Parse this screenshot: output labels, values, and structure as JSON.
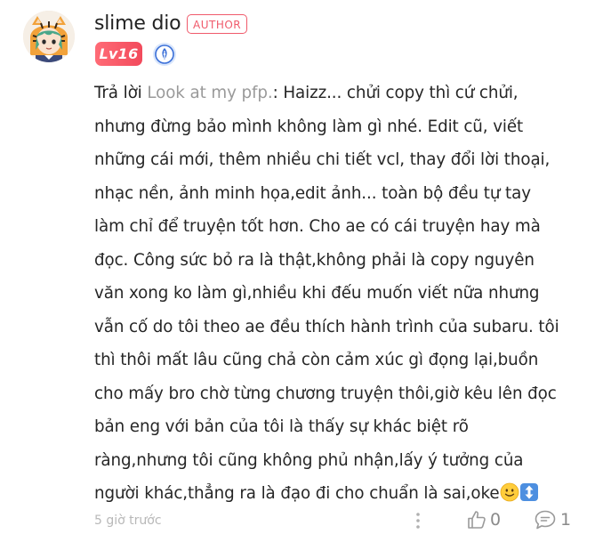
{
  "user": {
    "name": "slime dio",
    "author_badge": "AUTHOR",
    "level": "Lv16"
  },
  "comment": {
    "reply_prefix": "Trả lời ",
    "reply_to": "Look at my pfp.",
    "reply_rest": ": Haizz... chửi copy thì cứ chửi,\nnhưng đừng bảo mình không làm gì nhé. Edit cũ, viết\nnhững cái mới, thêm nhiều chi tiết vcl, thay đổi lời thoại,\nnhạc nền, ảnh minh họa,edit ảnh... toàn bộ đều tự tay\nlàm chỉ để truyện tốt hơn. Cho ae có cái truyện hay mà\nđọc. Công sức bỏ ra là thật,không phải là copy nguyên\nvăn xong ko làm gì,nhiều khi đếu muốn viết nữa nhưng\nvẫn cố do tôi theo ae đều thích hành trình của subaru. tôi\nthì thôi mất lâu cũng chả còn cảm xúc gì đọng lại,buồn\ncho mấy bro chờ từng chương truyện thôi,giờ kêu lên đọc\nbản eng với bản của tôi là thấy sự khác biệt rõ\nràng,nhưng tôi cũng không phủ nhận,lấy ý tưởng của\nngười khác,thẳng ra là đạo đi cho chuẩn là sai,oke",
    "emojis": [
      "slightly-smiling-face",
      "up-down-arrow"
    ]
  },
  "footer": {
    "timestamp": "5 giờ trước",
    "like_count": "0",
    "reply_count": "1"
  },
  "colors": {
    "accent": "#f05a6b",
    "muted": "#9a9a9a",
    "quill_blue": "#3a6fd8"
  },
  "icons": {
    "avatar": "tiger-hood-avatar",
    "level_badge": "level-badge",
    "quill": "quill-pen-badge-icon",
    "more": "more-vertical-icon",
    "like": "thumbs-up-icon",
    "reply": "comment-bubble-icon"
  }
}
